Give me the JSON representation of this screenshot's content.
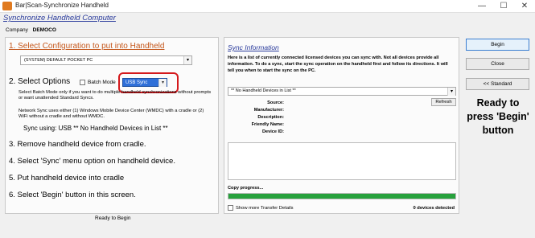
{
  "window": {
    "title": "Bar|Scan-Synchronize Handheld",
    "minimize": "—",
    "maximize": "☐",
    "close": "✕"
  },
  "header": {
    "title": "Synchronize Handheld Computer",
    "company_label": "Company",
    "company_value": "DEMOCO"
  },
  "left": {
    "step1_title": "1. Select Configuration to put into Handheld",
    "config_value": "(SYSTEM) DEFAULT POCKET PC",
    "step2_title": "2. Select Options",
    "batch_mode_label": "Batch Mode",
    "sync_type_value": "USB Sync",
    "batch_help": "Select Batch Mode only if you want to do multiple handheld synchronizations without prompts or want unattended Standard Syncs.",
    "network_help": "Network Sync uses either (1) Windows Mobile Device Center (WMDC)  with a cradle or (2) WiFi without a cradle and without WMDC.",
    "sync_using": "Sync using: USB ** No Handheld Devices in List **",
    "step3": "3. Remove handheld device from cradle.",
    "step4": "4. Select 'Sync' menu option on handheld device.",
    "step5": "5. Put handheld device into cradle",
    "step6": "6. Select 'Begin' button in this screen.",
    "status": "Ready to Begin"
  },
  "right": {
    "title": "Sync Information",
    "description": "Here is a list of currently connected licensed devices you can sync with. Not all devices provide all information. To do a sync, start the sync operation on the handheld first and follow its directions. It will tell you when to start the sync on the PC.",
    "device_select_value": "** No Handheld Devices in List **",
    "refresh_label": "Refresh",
    "fields": {
      "source": "Source:",
      "manufacturer": "Manufacturer:",
      "description": "Description:",
      "friendly_name": "Friendly Name:",
      "device_id": "Device ID:"
    },
    "copy_progress": "Copy progress...",
    "progress_fraction": 1.0,
    "show_more": "Show more Transfer Details",
    "devices_detected": "0 devices detected"
  },
  "buttons": {
    "begin": "Begin",
    "close": "Close",
    "standard": "<< Standard"
  },
  "hint": {
    "line1": "Ready to",
    "line2": "press 'Begin'",
    "line3": "button"
  },
  "colors": {
    "accent_title": "#2a3b9c",
    "step1_orange": "#c4561a",
    "highlight_red": "#d4191c",
    "progress_green": "#27a13c",
    "usb_select_blue": "#2f6fd8"
  }
}
